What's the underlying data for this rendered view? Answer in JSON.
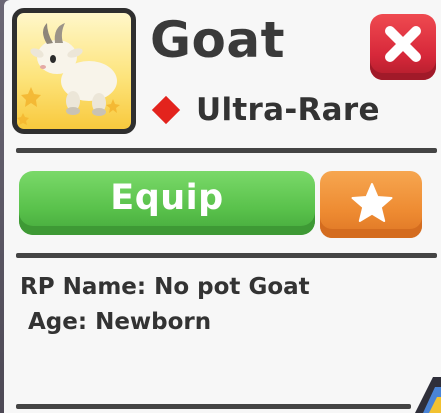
{
  "pet": {
    "name": "Goat",
    "rarity": "Ultra-Rare",
    "rarity_color": "#e3231d"
  },
  "actions": {
    "equip_label": "Equip",
    "favorite_icon": "star-icon",
    "close_icon": "close-icon"
  },
  "details": {
    "rp_name_line": "RP Name: No pot Goat",
    "age_line": "Age: Newborn"
  },
  "colors": {
    "equip_button": "#59c14b",
    "favorite_button": "#ee8b32",
    "close_button": "#d7283a",
    "thumbnail_bg": "#fde47c"
  }
}
